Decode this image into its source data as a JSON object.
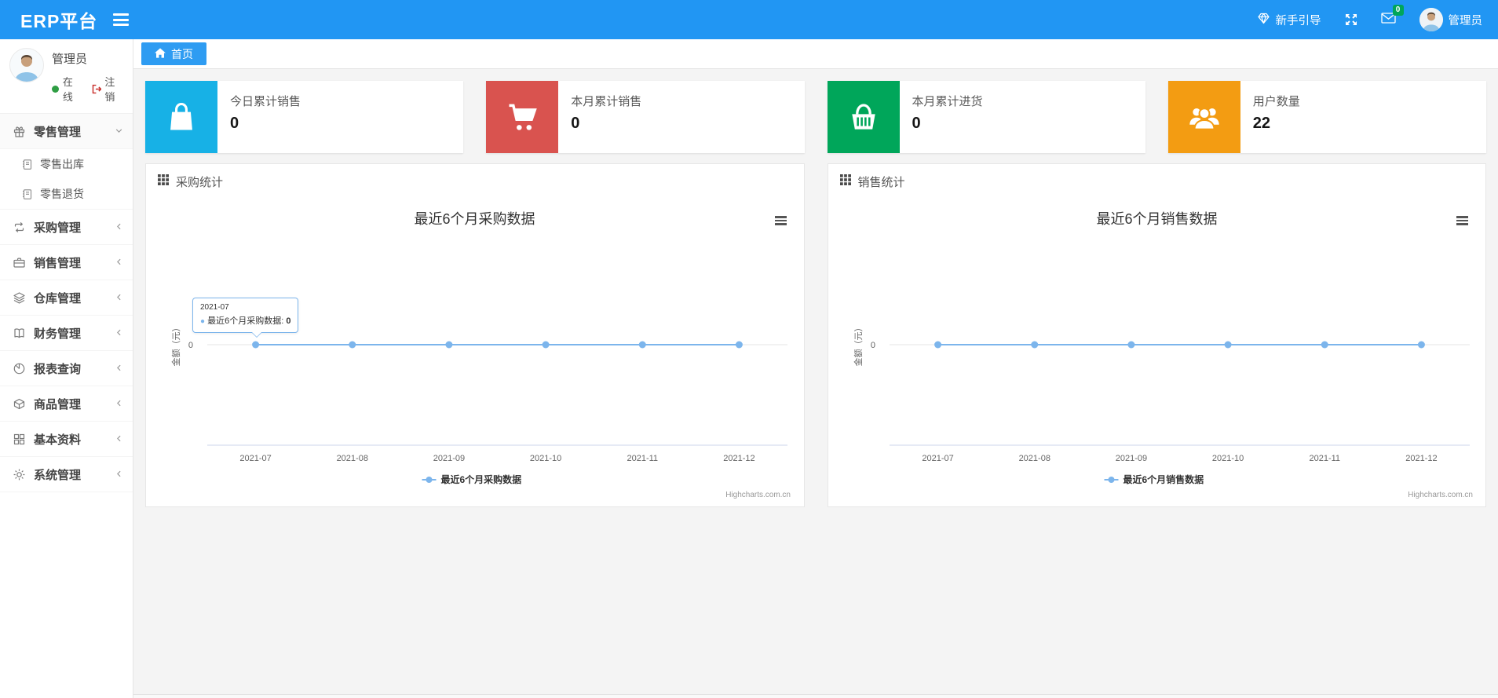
{
  "navbar": {
    "brand": "ERP平台",
    "guide_label": "新手引导",
    "message_badge": "0",
    "username": "管理员"
  },
  "sidebar": {
    "user": {
      "name": "管理员",
      "status": "在线",
      "logout": "注销"
    },
    "menu": [
      {
        "label": "零售管理",
        "icon": "gift-icon",
        "state": "expanded",
        "children": [
          {
            "label": "零售出库"
          },
          {
            "label": "零售退货"
          }
        ]
      },
      {
        "label": "采购管理",
        "icon": "repeat-icon"
      },
      {
        "label": "销售管理",
        "icon": "briefcase-icon"
      },
      {
        "label": "仓库管理",
        "icon": "layers-icon"
      },
      {
        "label": "财务管理",
        "icon": "open-book-icon"
      },
      {
        "label": "报表查询",
        "icon": "pie-chart-icon"
      },
      {
        "label": "商品管理",
        "icon": "package-icon"
      },
      {
        "label": "基本资料",
        "icon": "grid-icon"
      },
      {
        "label": "系统管理",
        "icon": "gear-icon"
      }
    ]
  },
  "tabs": [
    {
      "label": "首页",
      "active": true
    }
  ],
  "stat_cards": [
    {
      "title": "今日累计销售",
      "value": "0",
      "color": "#17b1e6",
      "icon": "shopping-bag-icon"
    },
    {
      "title": "本月累计销售",
      "value": "0",
      "color": "#d9534f",
      "icon": "cart-icon"
    },
    {
      "title": "本月累计进货",
      "value": "0",
      "color": "#00a65a",
      "icon": "basket-icon"
    },
    {
      "title": "用户数量",
      "value": "22",
      "color": "#f39c12",
      "icon": "users-icon"
    }
  ],
  "chart_data": [
    {
      "type": "line",
      "panel_title": "采购统计",
      "title": "最近6个月采购数据",
      "categories": [
        "2021-07",
        "2021-08",
        "2021-09",
        "2021-10",
        "2021-11",
        "2021-12"
      ],
      "series": [
        {
          "name": "最近6个月采购数据",
          "values": [
            0,
            0,
            0,
            0,
            0,
            0
          ]
        }
      ],
      "ylabel": "金额（元）",
      "yticks": [
        "0"
      ],
      "ylim": [
        -1,
        1
      ],
      "line_color": "#7cb5ec",
      "grid": false,
      "legend_position": "bottom",
      "credit": "Highcharts.com.cn",
      "tooltip": {
        "x_label": "2021-07",
        "series_name": "最近6个月采购数据",
        "value": "0"
      }
    },
    {
      "type": "line",
      "panel_title": "销售统计",
      "title": "最近6个月销售数据",
      "categories": [
        "2021-07",
        "2021-08",
        "2021-09",
        "2021-10",
        "2021-11",
        "2021-12"
      ],
      "series": [
        {
          "name": "最近6个月销售数据",
          "values": [
            0,
            0,
            0,
            0,
            0,
            0
          ]
        }
      ],
      "ylabel": "金额（元）",
      "yticks": [
        "0"
      ],
      "ylim": [
        -1,
        1
      ],
      "line_color": "#7cb5ec",
      "grid": false,
      "legend_position": "bottom",
      "credit": "Highcharts.com.cn"
    }
  ]
}
